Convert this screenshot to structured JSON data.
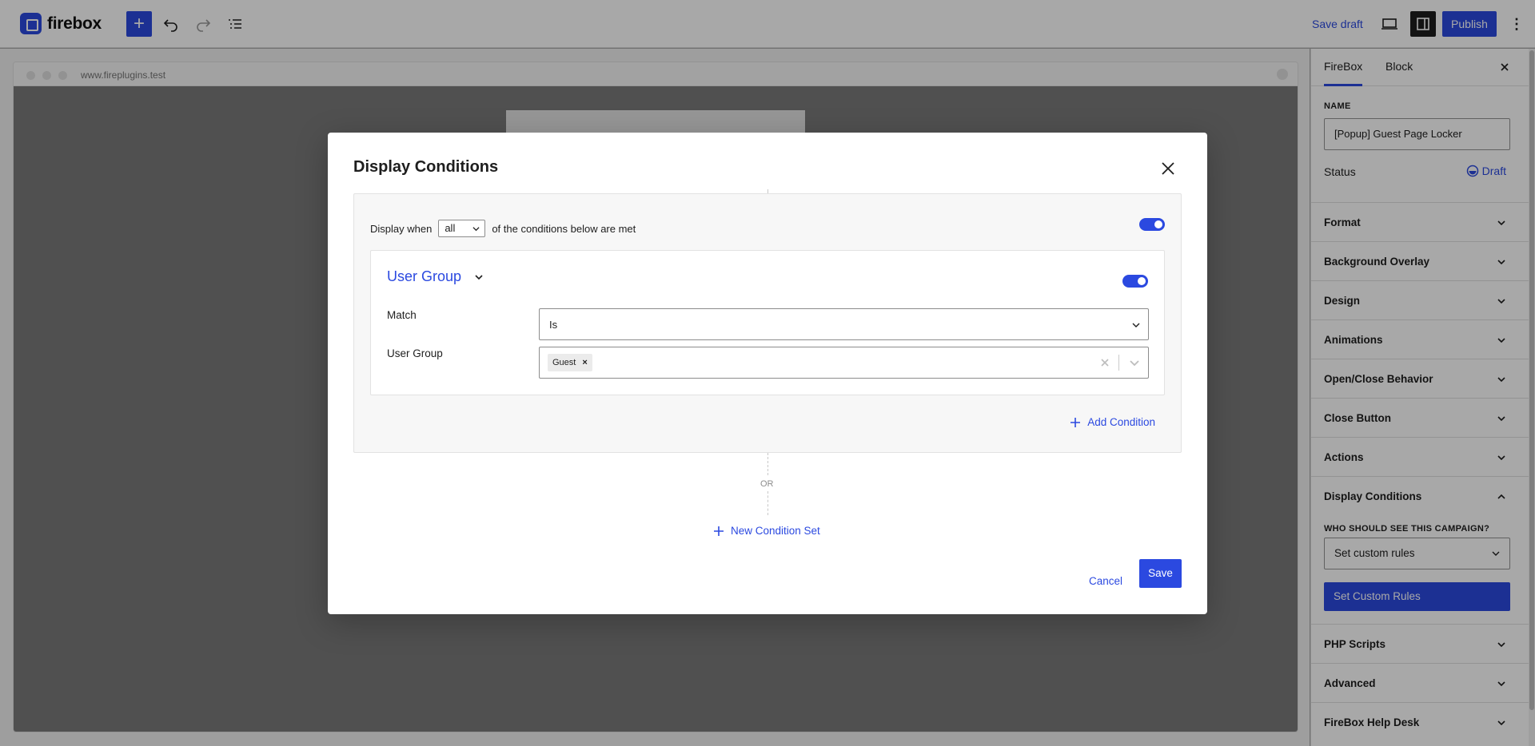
{
  "topbar": {
    "logo_text": "firebox",
    "save_draft_label": "Save draft",
    "publish_label": "Publish"
  },
  "browser": {
    "url": "www.fireplugins.test"
  },
  "sidebar": {
    "tabs": [
      {
        "label": "FireBox",
        "active": true
      },
      {
        "label": "Block",
        "active": false
      }
    ],
    "name_label": "NAME",
    "name_value": "[Popup] Guest Page Locker",
    "status_label": "Status",
    "status_value": "Draft",
    "panels": [
      {
        "title": "Format",
        "expanded": false
      },
      {
        "title": "Background Overlay",
        "expanded": false
      },
      {
        "title": "Design",
        "expanded": false
      },
      {
        "title": "Animations",
        "expanded": false
      },
      {
        "title": "Open/Close Behavior",
        "expanded": false
      },
      {
        "title": "Close Button",
        "expanded": false
      },
      {
        "title": "Actions",
        "expanded": false
      },
      {
        "title": "Display Conditions",
        "expanded": true
      },
      {
        "title": "PHP Scripts",
        "expanded": false
      },
      {
        "title": "Advanced",
        "expanded": false
      },
      {
        "title": "FireBox Help Desk",
        "expanded": false
      }
    ],
    "display_conditions": {
      "who_label": "WHO SHOULD SEE THIS CAMPAIGN?",
      "select_value": "Set custom rules",
      "button_label": "Set Custom Rules"
    }
  },
  "modal": {
    "title": "Display Conditions",
    "condition_set": {
      "prefix": "Display when",
      "match_value": "all",
      "suffix": "of the conditions below are met",
      "enabled": true,
      "condition": {
        "title": "User Group",
        "enabled": true,
        "match_label": "Match",
        "match_value": "Is",
        "field_label": "User Group",
        "selected_tags": [
          "Guest"
        ]
      },
      "add_condition_label": "Add Condition"
    },
    "or_label": "OR",
    "new_condition_set_label": "New Condition Set",
    "cancel_label": "Cancel",
    "save_label": "Save"
  },
  "colors": {
    "accent": "#2b49e0",
    "text": "#1e1e1e",
    "overlay": "rgba(0,0,0,0.34)"
  }
}
